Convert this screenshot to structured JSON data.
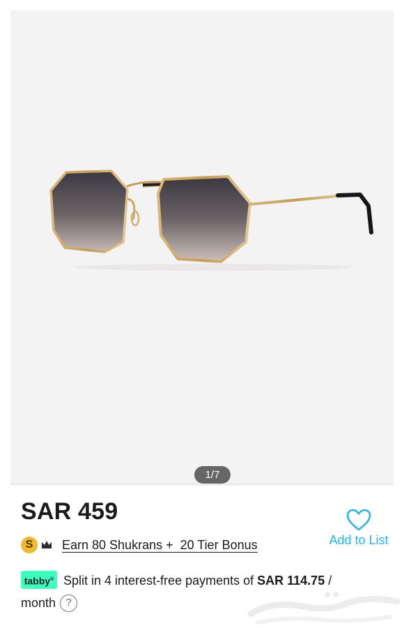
{
  "gallery": {
    "pager": "1/7"
  },
  "product": {
    "price": "SAR 459"
  },
  "shukrans": {
    "badge": "S",
    "earn_text": "Earn 80 Shukrans +  20 Tier Bonus"
  },
  "wishlist": {
    "label": "Add to List"
  },
  "tabby": {
    "logo": "tabby",
    "text_before": "Split in 4 interest-free payments of ",
    "amount": "SAR 114.75",
    "text_after": " / month",
    "help": "?"
  },
  "icons": {
    "badge": "shukran-s-icon",
    "tier": "crown-icon",
    "wishlist": "heart-outline-icon",
    "help": "question-mark-icon"
  },
  "colors": {
    "accent": "#2ab3e6",
    "tabby": "#3effbd",
    "shukran": "#f0b931",
    "frame": "#c9a56a"
  }
}
